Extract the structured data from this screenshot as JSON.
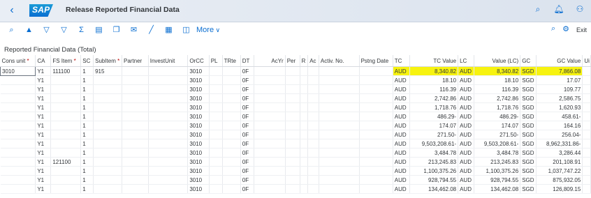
{
  "shell": {
    "back_icon": "chevron-left-icon",
    "logo_text": "SAP",
    "title": "Release Reported Financial Data",
    "icons": [
      "search-icon",
      "bell-icon",
      "user-icon"
    ]
  },
  "toolbar": {
    "buttons": [
      {
        "icon": "search-zoom-icon"
      },
      {
        "icon": "sort-up-icon"
      },
      {
        "icon": "sort-down-icon"
      },
      {
        "icon": "filter-icon"
      },
      {
        "icon": "sum-icon"
      },
      {
        "icon": "print-icon"
      },
      {
        "icon": "copy-icon"
      },
      {
        "icon": "mail-icon"
      },
      {
        "icon": "chart-icon"
      },
      {
        "icon": "grid-icon"
      },
      {
        "icon": "layout-icon"
      }
    ],
    "more_label": "More",
    "right_icons": [
      "search-icon",
      "settings-icon"
    ],
    "exit_label": "Exit"
  },
  "section_title": "Reported Financial Data (Total)",
  "table": {
    "columns": [
      {
        "label": "Cons unit",
        "req": true
      },
      {
        "label": "CA",
        "req": false
      },
      {
        "label": "FS Item",
        "req": true
      },
      {
        "label": "SC",
        "req": false
      },
      {
        "label": "SubItem",
        "req": true
      },
      {
        "label": "Partner",
        "req": false
      },
      {
        "label": "InvestUnit",
        "req": false
      },
      {
        "label": "OrCC",
        "req": false
      },
      {
        "label": "PL",
        "req": false
      },
      {
        "label": "TRte",
        "req": false
      },
      {
        "label": "DT",
        "req": false
      },
      {
        "label": "AcYr",
        "req": false
      },
      {
        "label": "Per",
        "req": false
      },
      {
        "label": "R",
        "req": false
      },
      {
        "label": "Ac",
        "req": false
      },
      {
        "label": "Activ. No.",
        "req": false
      },
      {
        "label": "Pstng Date",
        "req": false
      },
      {
        "label": "TC",
        "req": false
      },
      {
        "label": "TC Value",
        "req": false
      },
      {
        "label": "LC",
        "req": false
      },
      {
        "label": "Value (LC)",
        "req": false
      },
      {
        "label": "GC",
        "req": false
      },
      {
        "label": "GC Value",
        "req": false
      },
      {
        "label": "Ui",
        "req": false
      }
    ],
    "rows": [
      {
        "cons_unit": "3010",
        "ca": "Y1",
        "fs_item": "111100",
        "sc": "1",
        "subitem": "915",
        "orcc": "3010",
        "dt": "0F",
        "tc": "AUD",
        "tc_value": "8,340.82",
        "lc": "AUD",
        "value_lc": "8,340.82",
        "gc": "SGD",
        "gc_value": "7,866.08"
      },
      {
        "cons_unit": "",
        "ca": "Y1",
        "fs_item": "",
        "sc": "1",
        "subitem": "",
        "orcc": "3010",
        "dt": "0F",
        "tc": "AUD",
        "tc_value": "18.10",
        "lc": "AUD",
        "value_lc": "18.10",
        "gc": "SGD",
        "gc_value": "17.07"
      },
      {
        "cons_unit": "",
        "ca": "Y1",
        "fs_item": "",
        "sc": "1",
        "subitem": "",
        "orcc": "3010",
        "dt": "0F",
        "tc": "AUD",
        "tc_value": "116.39",
        "lc": "AUD",
        "value_lc": "116.39",
        "gc": "SGD",
        "gc_value": "109.77"
      },
      {
        "cons_unit": "",
        "ca": "Y1",
        "fs_item": "",
        "sc": "1",
        "subitem": "",
        "orcc": "3010",
        "dt": "0F",
        "tc": "AUD",
        "tc_value": "2,742.86",
        "lc": "AUD",
        "value_lc": "2,742.86",
        "gc": "SGD",
        "gc_value": "2,586.75"
      },
      {
        "cons_unit": "",
        "ca": "Y1",
        "fs_item": "",
        "sc": "1",
        "subitem": "",
        "orcc": "3010",
        "dt": "0F",
        "tc": "AUD",
        "tc_value": "1,718.76",
        "lc": "AUD",
        "value_lc": "1,718.76",
        "gc": "SGD",
        "gc_value": "1,620.93"
      },
      {
        "cons_unit": "",
        "ca": "Y1",
        "fs_item": "",
        "sc": "1",
        "subitem": "",
        "orcc": "3010",
        "dt": "0F",
        "tc": "AUD",
        "tc_value": "486.29-",
        "lc": "AUD",
        "value_lc": "486.29-",
        "gc": "SGD",
        "gc_value": "458.61-"
      },
      {
        "cons_unit": "",
        "ca": "Y1",
        "fs_item": "",
        "sc": "1",
        "subitem": "",
        "orcc": "3010",
        "dt": "0F",
        "tc": "AUD",
        "tc_value": "174.07",
        "lc": "AUD",
        "value_lc": "174.07",
        "gc": "SGD",
        "gc_value": "164.16"
      },
      {
        "cons_unit": "",
        "ca": "Y1",
        "fs_item": "",
        "sc": "1",
        "subitem": "",
        "orcc": "3010",
        "dt": "0F",
        "tc": "AUD",
        "tc_value": "271.50-",
        "lc": "AUD",
        "value_lc": "271.50-",
        "gc": "SGD",
        "gc_value": "256.04-"
      },
      {
        "cons_unit": "",
        "ca": "Y1",
        "fs_item": "",
        "sc": "1",
        "subitem": "",
        "orcc": "3010",
        "dt": "0F",
        "tc": "AUD",
        "tc_value": "9,503,208.61-",
        "lc": "AUD",
        "value_lc": "9,503,208.61-",
        "gc": "SGD",
        "gc_value": "8,962,331.86-"
      },
      {
        "cons_unit": "",
        "ca": "Y1",
        "fs_item": "",
        "sc": "1",
        "subitem": "",
        "orcc": "3010",
        "dt": "0F",
        "tc": "AUD",
        "tc_value": "3,484.78",
        "lc": "AUD",
        "value_lc": "3,484.78",
        "gc": "SGD",
        "gc_value": "3,286.44"
      },
      {
        "cons_unit": "",
        "ca": "Y1",
        "fs_item": "121100",
        "sc": "1",
        "subitem": "",
        "orcc": "3010",
        "dt": "0F",
        "tc": "AUD",
        "tc_value": "213,245.83",
        "lc": "AUD",
        "value_lc": "213,245.83",
        "gc": "SGD",
        "gc_value": "201,108.91"
      },
      {
        "cons_unit": "",
        "ca": "Y1",
        "fs_item": "",
        "sc": "1",
        "subitem": "",
        "orcc": "3010",
        "dt": "0F",
        "tc": "AUD",
        "tc_value": "1,100,375.26",
        "lc": "AUD",
        "value_lc": "1,100,375.26",
        "gc": "SGD",
        "gc_value": "1,037,747.22"
      },
      {
        "cons_unit": "",
        "ca": "Y1",
        "fs_item": "",
        "sc": "1",
        "subitem": "",
        "orcc": "3010",
        "dt": "0F",
        "tc": "AUD",
        "tc_value": "928,794.55",
        "lc": "AUD",
        "value_lc": "928,794.55",
        "gc": "SGD",
        "gc_value": "875,932.05"
      },
      {
        "cons_unit": "",
        "ca": "Y1",
        "fs_item": "",
        "sc": "1",
        "subitem": "",
        "orcc": "3010",
        "dt": "0F",
        "tc": "AUD",
        "tc_value": "134,462.08",
        "lc": "AUD",
        "value_lc": "134,462.08",
        "gc": "SGD",
        "gc_value": "126,809.15"
      }
    ]
  },
  "colors": {
    "accent": "#0a6ed1",
    "highlight": "#f7f30f",
    "text": "#32363a"
  }
}
